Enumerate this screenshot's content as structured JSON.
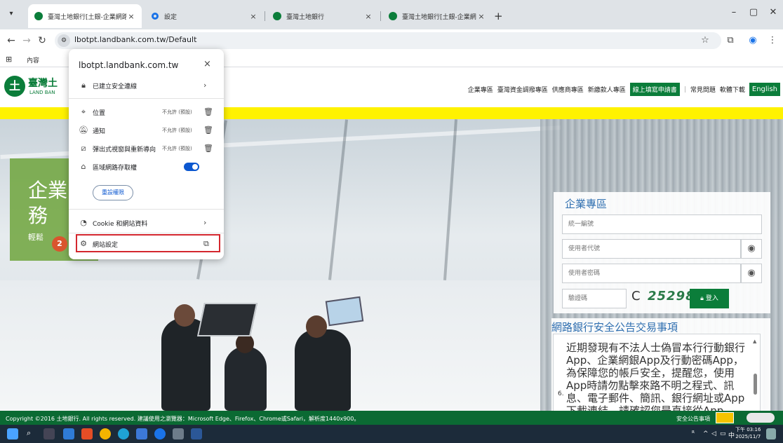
{
  "browser": {
    "tabs": [
      {
        "title": "臺灣土地銀行[土銀-企業網路銀",
        "close": "×"
      },
      {
        "title": "設定",
        "close": "×"
      },
      {
        "title": "臺灣土地銀行",
        "close": "×"
      },
      {
        "title": "臺灣土地銀行[土銀-企業網路銀",
        "close": "×"
      }
    ],
    "new_tab": "+",
    "url": "lbotpt.landbank.com.tw/Default",
    "bookmark_label": "內容"
  },
  "popup": {
    "host": "lbotpt.landbank.com.tw",
    "close": "×",
    "secure_connection": "已建立安全連線",
    "permissions": [
      {
        "label": "位置",
        "value": "不允許 (預設)"
      },
      {
        "label": "通知",
        "value": "不允許 (預設)"
      },
      {
        "label": "彈出式視窗與重新導向",
        "value": "不允許 (預設)"
      }
    ],
    "local_network": "區域網路存取權",
    "reset_button": "重設權限",
    "cookie": "Cookie 和網站資料",
    "site_settings": "網站設定",
    "step_number": "2"
  },
  "site": {
    "logo_text": "臺灣土",
    "logo_sub": "LAND BAN",
    "nav": {
      "item1": "企業專區",
      "item2": "臺灣資金調撥專區",
      "item3": "供應商專區",
      "item4": "新繳款人專區",
      "apply": "線上填寫申請書",
      "faq": "常見問題",
      "download": "軟體下載",
      "english": "English"
    },
    "promo": {
      "line1": "企業",
      "line2": "務",
      "small": "輕鬆"
    },
    "login": {
      "title": "企業專區",
      "tax_id_placeholder": "統一編號",
      "user_id_placeholder": "使用者代號",
      "password_placeholder": "使用者密碼",
      "captcha_placeholder": "驗證碼",
      "captcha_code": "25298",
      "login_button": "登入"
    },
    "notice": {
      "title": "網路銀行安全公告交易事項",
      "item_number": "6.",
      "text": "近期發現有不法人士偽冒本行行動銀行App、企業網銀App及行動密碼App，為保障您的帳戶安全，提醒您，使用App時請勿點擊來路不明之程式、訊息、電子郵件、簡訊、銀行網址或App下載連結，請確認您是直接從App Store或Google Play下載本行App。"
    },
    "footer": {
      "copyright": "Copyright ©2016 土地銀行. All rights reserved. 建議使用之瀏覽器：Microsoft Edge、Firefox、Chrome或Safari，解析度1440x900。",
      "security": "安全公告事項"
    }
  },
  "taskbar": {
    "clock_time": "下午 03:16",
    "clock_date": "2025/11/7",
    "ime": "中"
  }
}
